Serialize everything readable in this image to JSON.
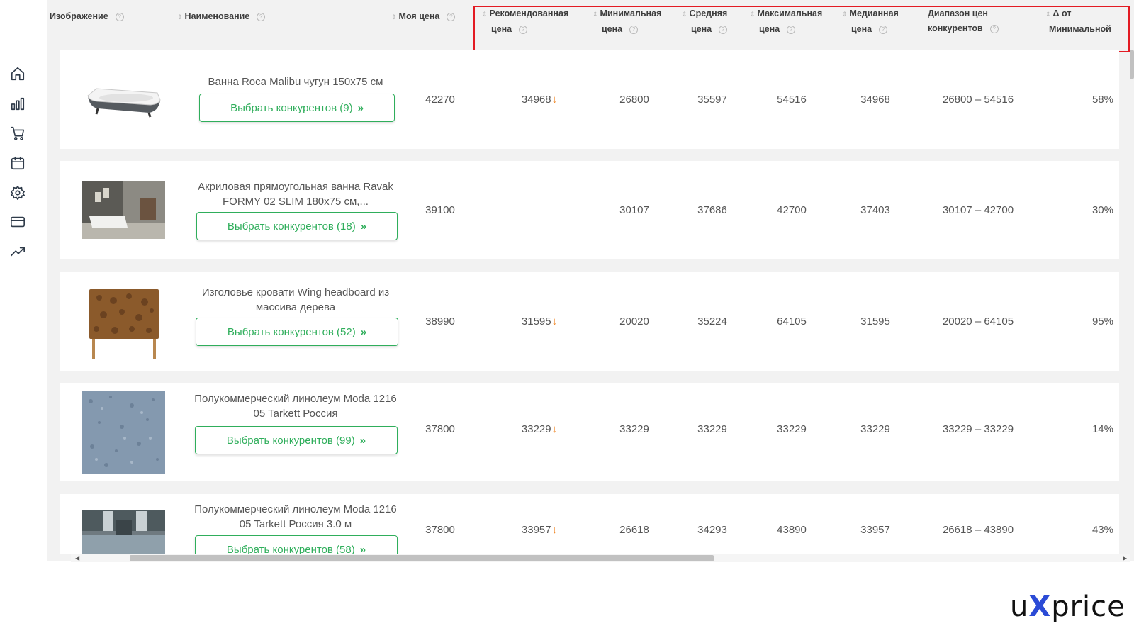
{
  "sidebar": {
    "icons": [
      "home-icon",
      "bar-chart-icon",
      "cart-icon",
      "calendar-icon",
      "settings-icon",
      "card-icon",
      "trend-icon"
    ]
  },
  "header": {
    "image": "Изображение",
    "name": "Наименование",
    "my_price": "Моя цена",
    "recommended_1": "Рекомендованная",
    "recommended_2": "цена",
    "min_1": "Минимальная",
    "min_2": "цена",
    "avg_1": "Средняя",
    "avg_2": "цена",
    "max_1": "Максимальная",
    "max_2": "цена",
    "median_1": "Медианная",
    "median_2": "цена",
    "range_1": "Диапазон цен",
    "range_2": "конкурентов",
    "delta_1": "Δ от",
    "delta_2": "Минимальной"
  },
  "rows": [
    {
      "name": "Ванна Roca Malibu чугун 150х75 см",
      "button": "Выбрать конкурентов (9)",
      "my_price": "42270",
      "recommended": "34968",
      "recommended_down": true,
      "min": "26800",
      "avg": "35597",
      "max": "54516",
      "median": "34968",
      "range": "26800 – 54516",
      "delta": "58%"
    },
    {
      "name": "Акриловая прямоугольная ванна Ravak FORMY 02 SLIM 180x75 см,...",
      "button": "Выбрать конкурентов (18)",
      "my_price": "39100",
      "recommended": "",
      "recommended_down": false,
      "min": "30107",
      "avg": "37686",
      "max": "42700",
      "median": "37403",
      "range": "30107 – 42700",
      "delta": "30%"
    },
    {
      "name": "Изголовье кровати Wing headboard из массива дерева",
      "button": "Выбрать конкурентов (52)",
      "my_price": "38990",
      "recommended": "31595",
      "recommended_down": true,
      "min": "20020",
      "avg": "35224",
      "max": "64105",
      "median": "31595",
      "range": "20020 – 64105",
      "delta": "95%"
    },
    {
      "name": "Полукоммерческий линолеум Moda 1216 05 Tarkett Россия",
      "button": "Выбрать конкурентов (99)",
      "my_price": "37800",
      "recommended": "33229",
      "recommended_down": true,
      "min": "33229",
      "avg": "33229",
      "max": "33229",
      "median": "33229",
      "range": "33229 – 33229",
      "delta": "14%"
    },
    {
      "name": "Полукоммерческий линолеум Moda 1216 05 Tarkett Россия 3.0 м",
      "button": "Выбрать конкурентов (58)",
      "my_price": "37800",
      "recommended": "33957",
      "recommended_down": true,
      "min": "26618",
      "avg": "34293",
      "max": "43890",
      "median": "33957",
      "range": "26618 – 43890",
      "delta": "43%"
    }
  ],
  "brand": {
    "prefix": "u",
    "x": "X",
    "suffix": "price"
  }
}
